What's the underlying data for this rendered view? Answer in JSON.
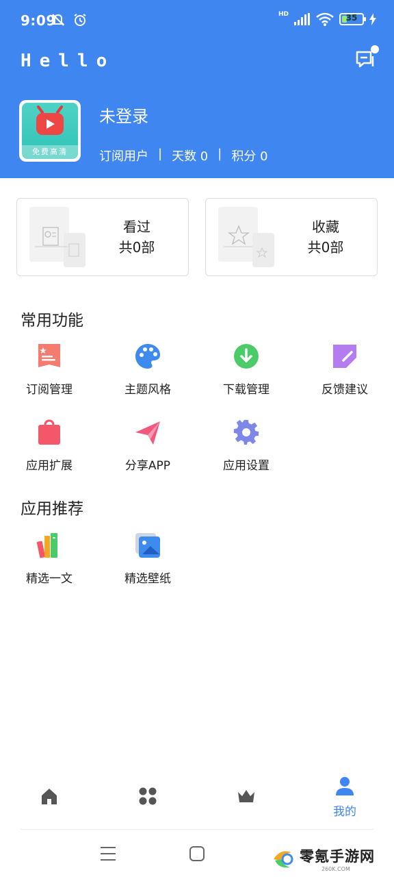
{
  "status_bar": {
    "time": "9:09",
    "network_label": "HD",
    "battery_level": "35",
    "battery_fraction": 0.35
  },
  "header": {
    "app_name": "Hello",
    "avatar_tag": "免费高清",
    "login_status": "未登录",
    "user_type": "订阅用户",
    "separator": "|",
    "days": "天数 0",
    "points": "积分 0"
  },
  "stats": {
    "watched": {
      "label": "看过",
      "count": "共0部"
    },
    "favorites": {
      "label": "收藏",
      "count": "共0部"
    }
  },
  "common_functions": {
    "title": "常用功能",
    "items": [
      {
        "label": "订阅管理",
        "icon": "subscription-icon",
        "color": "#F47C6E"
      },
      {
        "label": "主题风格",
        "icon": "palette-icon",
        "color": "#3E8BF0"
      },
      {
        "label": "下载管理",
        "icon": "download-icon",
        "color": "#4CCB6A"
      },
      {
        "label": "反馈建议",
        "icon": "feedback-edit-icon",
        "color": "#B57CF0"
      },
      {
        "label": "应用扩展",
        "icon": "shopping-bag-icon",
        "color": "#F2576A"
      },
      {
        "label": "分享APP",
        "icon": "paper-plane-icon",
        "color": "#F2577E"
      },
      {
        "label": "应用设置",
        "icon": "gear-icon",
        "color": "#7D87E8"
      }
    ]
  },
  "recommended_apps": {
    "title": "应用推荐",
    "items": [
      {
        "label": "精选一文",
        "icon": "books-icon"
      },
      {
        "label": "精选壁纸",
        "icon": "wallpaper-icon"
      }
    ]
  },
  "bottom_nav": {
    "items": [
      {
        "icon": "home-icon",
        "label": ""
      },
      {
        "icon": "grid-icon",
        "label": ""
      },
      {
        "icon": "crown-icon",
        "label": ""
      },
      {
        "icon": "profile-icon",
        "label": "我的"
      }
    ],
    "active_color": "#3F86F1",
    "inactive_color": "#555555"
  },
  "watermark": {
    "text": "零氪手游网",
    "sub": "260K.COM"
  },
  "colors": {
    "header_bg": "#3F86F1",
    "battery_fill": "#9FE870"
  }
}
